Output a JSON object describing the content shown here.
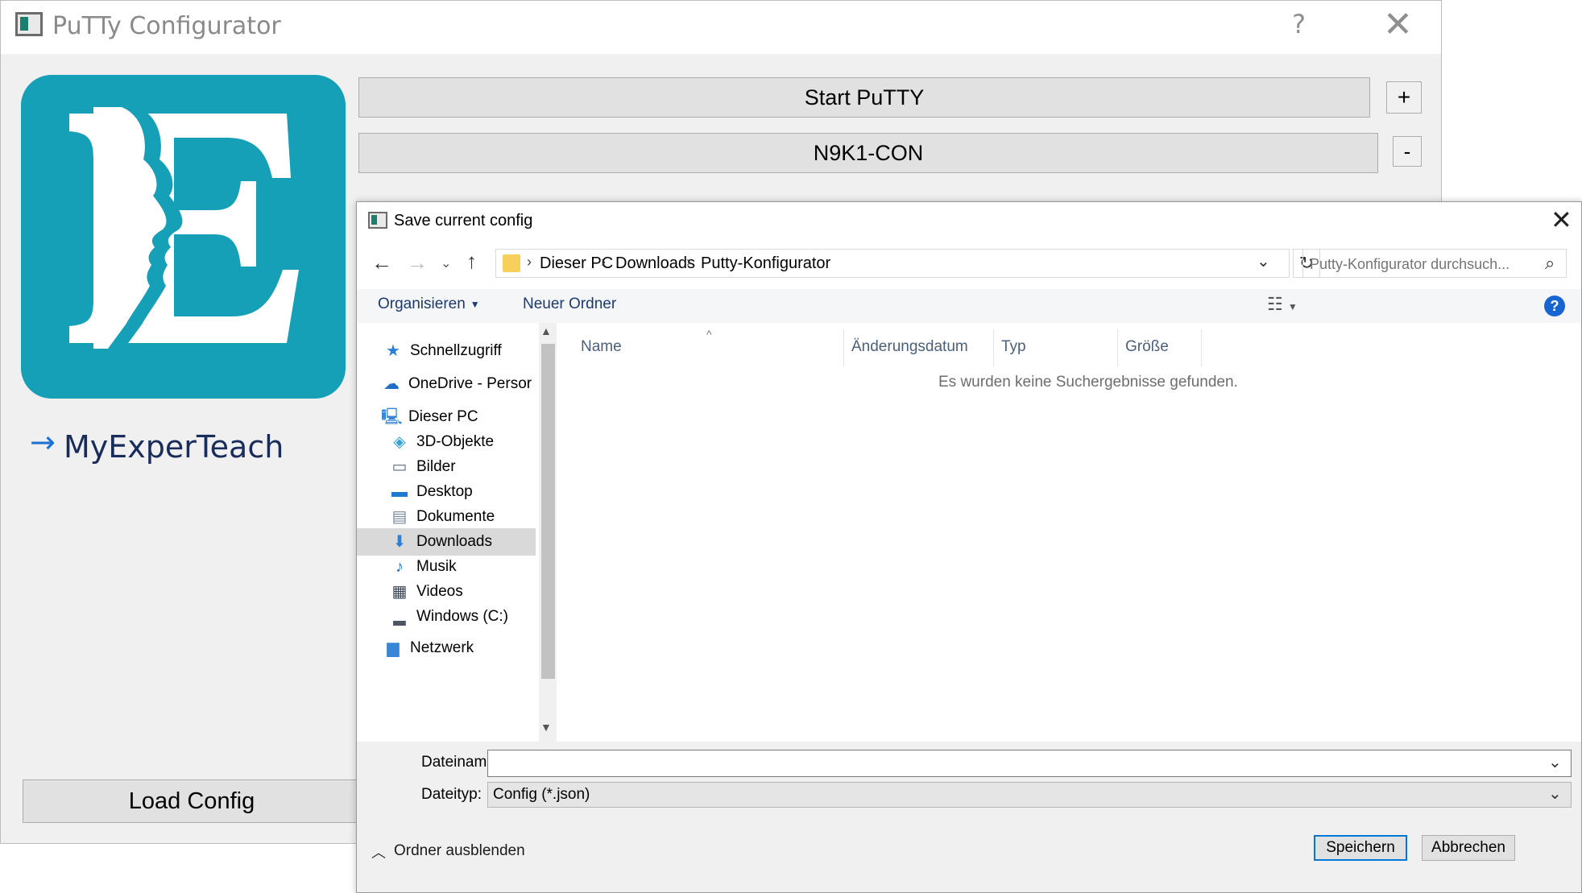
{
  "main_window": {
    "title": "PuTTy Configurator",
    "help_glyph": "?",
    "close_glyph": "✕",
    "start_button": "Start PuTTY",
    "plus_button": "+",
    "session_button": "N9K1-CON",
    "minus_button": "-",
    "brand_arrow": "→",
    "brand_name": "MyExperTeach",
    "load_button": "Load Config"
  },
  "dialog": {
    "title": "Save current config",
    "close_glyph": "✕",
    "nav": {
      "back": "←",
      "forward": "→",
      "recent": "⌄",
      "up": "↑"
    },
    "breadcrumb": [
      "Dieser PC",
      "Downloads",
      "Putty-Konfigurator"
    ],
    "breadcrumb_sep": "›",
    "search_placeholder": "Putty-Konfigurator durchsuch...",
    "toolbar": {
      "organize": "Organisieren",
      "new_folder": "Neuer Ordner",
      "help": "?"
    },
    "tree": [
      {
        "label": "Schnellzugriff",
        "icon": "star-icon",
        "glyph": "★",
        "color": "#2f7fd8"
      },
      {
        "label": "OneDrive - Persor",
        "icon": "cloud-icon",
        "glyph": "☁",
        "color": "#1f6fc8"
      },
      {
        "label": "Dieser PC",
        "icon": "computer-icon",
        "glyph": "🖳",
        "color": "#3a86d6"
      },
      {
        "label": "3D-Objekte",
        "icon": "cube-icon",
        "glyph": "◈",
        "color": "#35a3d8"
      },
      {
        "label": "Bilder",
        "icon": "picture-icon",
        "glyph": "▭",
        "color": "#5b6f85"
      },
      {
        "label": "Desktop",
        "icon": "desktop-icon",
        "glyph": "▬",
        "color": "#1f78d1"
      },
      {
        "label": "Dokumente",
        "icon": "document-icon",
        "glyph": "▤",
        "color": "#7b8a99"
      },
      {
        "label": "Downloads",
        "icon": "download-icon",
        "glyph": "⬇",
        "color": "#2e7fd6"
      },
      {
        "label": "Musik",
        "icon": "music-icon",
        "glyph": "♪",
        "color": "#1f78d1"
      },
      {
        "label": "Videos",
        "icon": "video-icon",
        "glyph": "▦",
        "color": "#3b4656"
      },
      {
        "label": "Windows (C:)",
        "icon": "drive-icon",
        "glyph": "▂",
        "color": "#4b5563"
      },
      {
        "label": "Netzwerk",
        "icon": "network-icon",
        "glyph": "▆",
        "color": "#3a86d6"
      }
    ],
    "selected_tree_index": 7,
    "columns": [
      "Name",
      "Änderungsdatum",
      "Typ",
      "Größe"
    ],
    "empty_message": "Es wurden keine Suchergebnisse gefunden.",
    "filename_label": "Dateiname:",
    "filename_value": "",
    "filetype_label": "Dateityp:",
    "filetype_value": "Config (*.json)",
    "hide_folders": "Ordner ausblenden",
    "save_button": "Speichern",
    "cancel_button": "Abbrechen"
  },
  "colors": {
    "logo_bg": "#16a0b7",
    "accent": "#0078d7",
    "brand_text": "#1a2d5a"
  }
}
